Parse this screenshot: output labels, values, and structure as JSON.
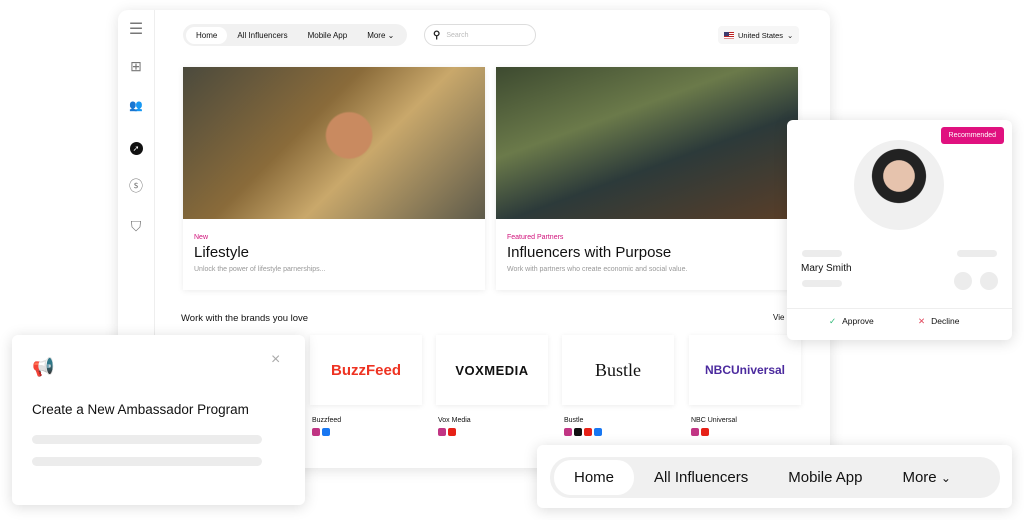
{
  "nav": {
    "items": [
      "Home",
      "All Influencers",
      "Mobile App",
      "More"
    ],
    "active": "Home"
  },
  "search": {
    "placeholder": "Search"
  },
  "country": {
    "label": "United States"
  },
  "sidebar": {
    "icons": [
      "menu-icon",
      "dashboard-icon",
      "people-icon",
      "compass-icon",
      "lightning-icon",
      "shield-icon"
    ],
    "active": "compass-icon"
  },
  "cards": [
    {
      "tag": "New",
      "title": "Lifestyle",
      "subtitle": "Unlock the power of lifestyle parnerships..."
    },
    {
      "tag": "Featured Partners",
      "title": "Influencers with Purpose",
      "subtitle": "Work with partners who create economic and social value."
    }
  ],
  "brands": {
    "heading": "Work with the brands you love",
    "view_all": "Vie",
    "items": [
      {
        "logo": "BuzzFeed",
        "name": "Buzzfeed",
        "socials": [
          "instagram",
          "facebook"
        ]
      },
      {
        "logo": "VOXMEDIA",
        "name": "Vox Media",
        "socials": [
          "instagram",
          "youtube"
        ]
      },
      {
        "logo": "Bustle",
        "name": "Bustle",
        "socials": [
          "instagram",
          "tiktok",
          "youtube",
          "facebook"
        ]
      },
      {
        "logo": "NBCUniversal",
        "name": "NBC Universal",
        "socials": [
          "instagram",
          "youtube"
        ]
      }
    ]
  },
  "popup": {
    "title": "Create a New Ambassador Program"
  },
  "profile": {
    "badge": "Recommended",
    "name": "Mary Smith",
    "approve": "Approve",
    "decline": "Decline"
  },
  "bottom_nav": {
    "items": [
      "Home",
      "All Influencers",
      "Mobile App",
      "More"
    ],
    "active": "Home"
  },
  "colors": {
    "accent": "#e0117f",
    "approve": "#2bb673",
    "decline": "#e0455a"
  }
}
